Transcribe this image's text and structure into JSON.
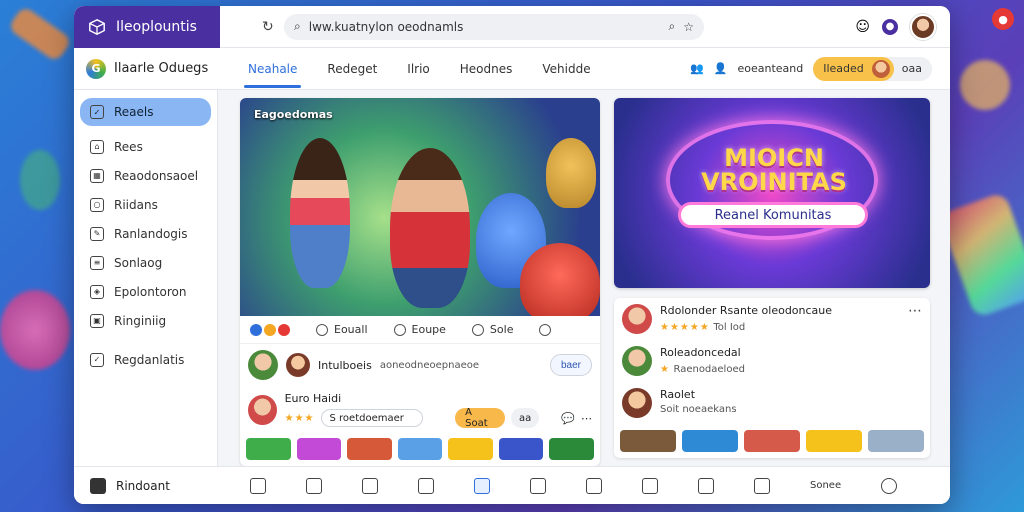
{
  "browser": {
    "brand": "Ileoplountis",
    "url": "lww.kuatnylon oeodnamls"
  },
  "app": {
    "name": "Ilaarle Oduegs",
    "tabs": [
      "Neahale",
      "Redeget",
      "Ilrio",
      "Heodnes",
      "Vehidde"
    ],
    "account_text": "eoeanteand",
    "pill_label": "Ileaded",
    "pill_extra": "oaa"
  },
  "sidebar": {
    "items": [
      "Reaels",
      "Rees",
      "Reaodonsaoel",
      "Riidans",
      "Ranlandogis",
      "Sonlaog",
      "Epolontoron",
      "Ringiniig",
      "Regdanlatis"
    ]
  },
  "hero_left": {
    "tag": "Eagoedomas"
  },
  "actions": {
    "items": [
      "Eouall",
      "Eoupe",
      "Sole",
      ""
    ]
  },
  "rows": {
    "r1_text": "Intulboeis",
    "r1_text2": "aoneodneoepnaeoe",
    "follow": "baer",
    "r2_title": "Euro Haidi",
    "r2_field": "S roetdoemaer",
    "r2_btn": "A Soat",
    "r2_btn2": "aa"
  },
  "hero_right": {
    "title": "MIOICN VROINITAS",
    "subtitle": "Reanel Komunitas"
  },
  "list_right": {
    "items": [
      {
        "title": "Rdolonder Rsante oleodoncaue",
        "sub": "Tol Iod"
      },
      {
        "title": "Roleadoncedal",
        "sub": "Raenodaeloed"
      },
      {
        "title": "Raolet",
        "sub": "Soit noeaekans"
      }
    ]
  },
  "bottombar": {
    "brand": "Rindoant",
    "label": "Sonee"
  },
  "colors": {
    "accent": "#2f6fdc",
    "brand": "#4a2fa0",
    "highlight": "#f8c24a"
  }
}
